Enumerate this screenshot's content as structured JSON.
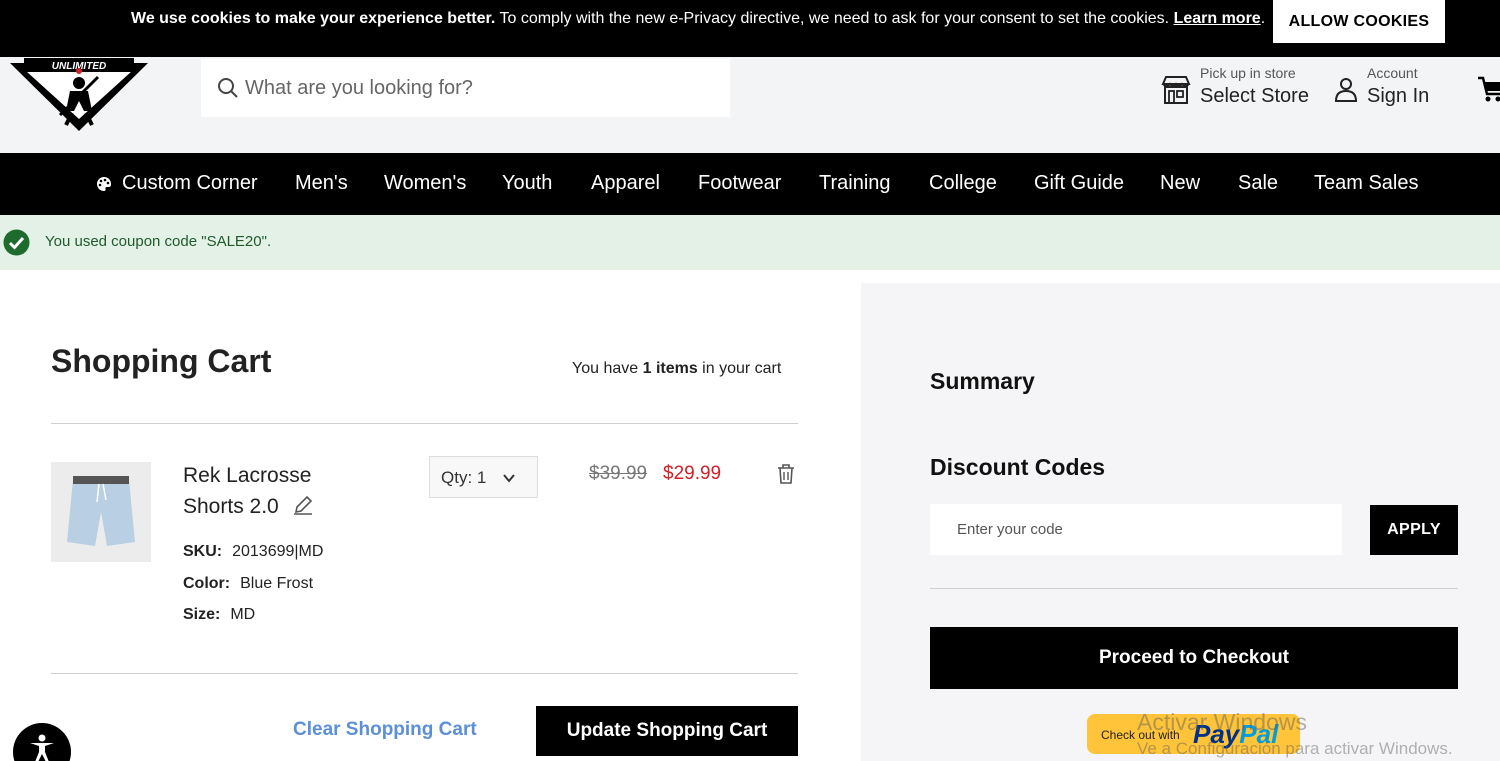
{
  "cookie_bar": {
    "bold_text": "We use cookies to make your experience better.",
    "text": " To comply with the new e-Privacy directive, we need to ask for your consent to set the cookies. ",
    "learn_more": "Learn more",
    "after_link": ".",
    "allow_label": "ALLOW COOKIES"
  },
  "header": {
    "logo_text": "UNLIMITED",
    "search_placeholder": "What are you looking for?",
    "store": {
      "small": "Pick up in store",
      "big": "Select Store"
    },
    "account": {
      "small": "Account",
      "big": "Sign In"
    }
  },
  "nav": {
    "items": [
      "Custom Corner",
      "Men's",
      "Women's",
      "Youth",
      "Apparel",
      "Footwear",
      "Training",
      "College",
      "Gift Guide",
      "New",
      "Sale",
      "Team Sales"
    ]
  },
  "message": {
    "text": "You used coupon code \"SALE20\"."
  },
  "cart": {
    "title": "Shopping Cart",
    "count_prefix": "You have ",
    "count_value": "1 items",
    "count_suffix": " in your cart",
    "item": {
      "name": "Rek Lacrosse Shorts 2.0",
      "sku_label": "SKU:",
      "sku_value": "2013699|MD",
      "color_label": "Color:",
      "color_value": "Blue Frost",
      "size_label": "Size:",
      "size_value": "MD",
      "qty_label": "Qty: 1",
      "old_price": "$39.99",
      "new_price": "$29.99"
    },
    "clear_label": "Clear Shopping Cart",
    "update_label": "Update Shopping Cart"
  },
  "summary": {
    "title": "Summary",
    "discount_title": "Discount Codes",
    "code_placeholder": "Enter your code",
    "apply_label": "APPLY",
    "checkout_label": "Proceed to Checkout",
    "paypal_small": "Check out with",
    "paypal_part1": "Pay",
    "paypal_part2": "Pal"
  },
  "watermark": {
    "line1": "Activar Windows",
    "line2": "Ve a Configuración para activar Windows."
  },
  "colors": {
    "price_red": "#d32027",
    "link_blue": "#5b8fd6",
    "success_bg": "#e4f1e6",
    "success_green": "#1d6b2d",
    "paypal_yellow": "#ffc439"
  }
}
